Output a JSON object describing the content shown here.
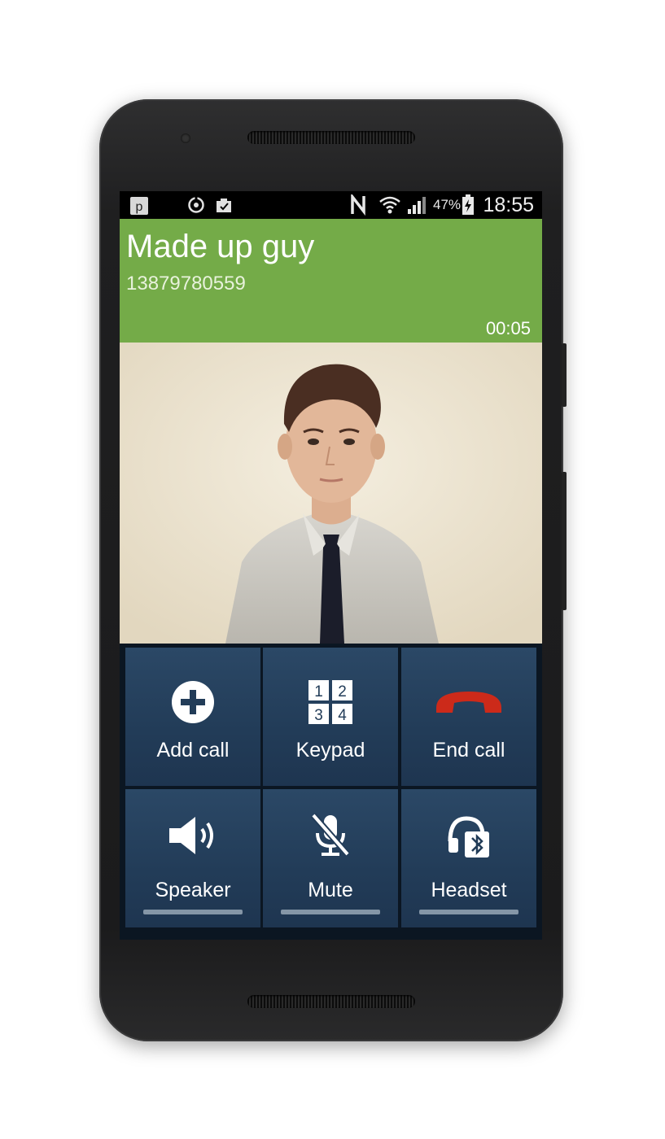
{
  "status_bar": {
    "battery_percent": "47%",
    "time": "18:55",
    "icons": [
      "notification-p-icon",
      "sync-icon",
      "clipboard-check-icon",
      "nfc-icon",
      "wifi-icon",
      "signal-icon",
      "battery-icon"
    ]
  },
  "call": {
    "name": "Made up guy",
    "number": "13879780559",
    "duration": "00:05"
  },
  "actions": [
    {
      "label": "Add call",
      "icon": "add-circle-icon"
    },
    {
      "label": "Keypad",
      "icon": "keypad-icon",
      "digits": [
        "1",
        "2",
        "3",
        "4"
      ]
    },
    {
      "label": "End call",
      "icon": "end-call-icon"
    },
    {
      "label": "Speaker",
      "icon": "speaker-icon"
    },
    {
      "label": "Mute",
      "icon": "mute-mic-icon"
    },
    {
      "label": "Headset",
      "icon": "bluetooth-headset-icon"
    }
  ],
  "colors": {
    "header_green": "#74ab48",
    "tile_blue": "#223c58",
    "end_call_red": "#cc2a1a"
  }
}
